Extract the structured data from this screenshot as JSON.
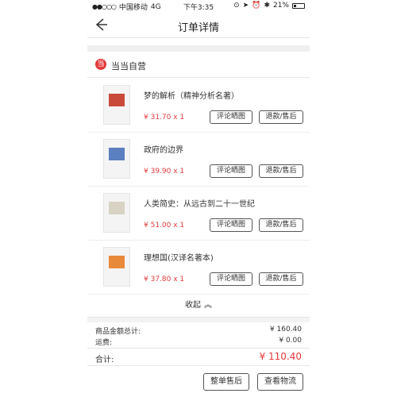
{
  "status_bar": {
    "signal_dots": "●●○○○",
    "carrier": "中国移动",
    "network": "4G",
    "time": "下午3:35",
    "battery": "21%"
  },
  "nav": {
    "title": "订单详情"
  },
  "shop": {
    "logo_text": "当",
    "name": "当当自营"
  },
  "items": [
    {
      "title": "梦的解析（精神分析名著）",
      "price": "¥ 31.70 x 1",
      "review_label": "评论晒图",
      "refund_label": "退款/售后",
      "cover_color": "#c94a3a"
    },
    {
      "title": "政府的边界",
      "price": "¥ 39.90 x 1",
      "review_label": "评论晒图",
      "refund_label": "退款/售后",
      "cover_color": "#5b7fbf"
    },
    {
      "title": "人类简史：从远古到二十一世纪",
      "price": "¥ 51.00 x 1",
      "review_label": "评论晒图",
      "refund_label": "退款/售后",
      "cover_color": "#d8d3c2"
    },
    {
      "title": "理想国(汉译名著本)",
      "price": "¥ 37.80 x 1",
      "review_label": "评论晒图",
      "refund_label": "退款/售后",
      "cover_color": "#e9893a"
    }
  ],
  "collapse": {
    "label": "收起"
  },
  "summary": {
    "goods_label": "商品金额总计:",
    "goods_value": "¥ 160.40",
    "shipping_label": "运费:",
    "shipping_value": "¥ 0.00",
    "total_label": "合计:",
    "total_value": "¥ 110.40"
  },
  "footer": {
    "after_sale_label": "整单售后",
    "logistics_label": "查看物流"
  },
  "colors": {
    "accent": "#e4393c"
  }
}
